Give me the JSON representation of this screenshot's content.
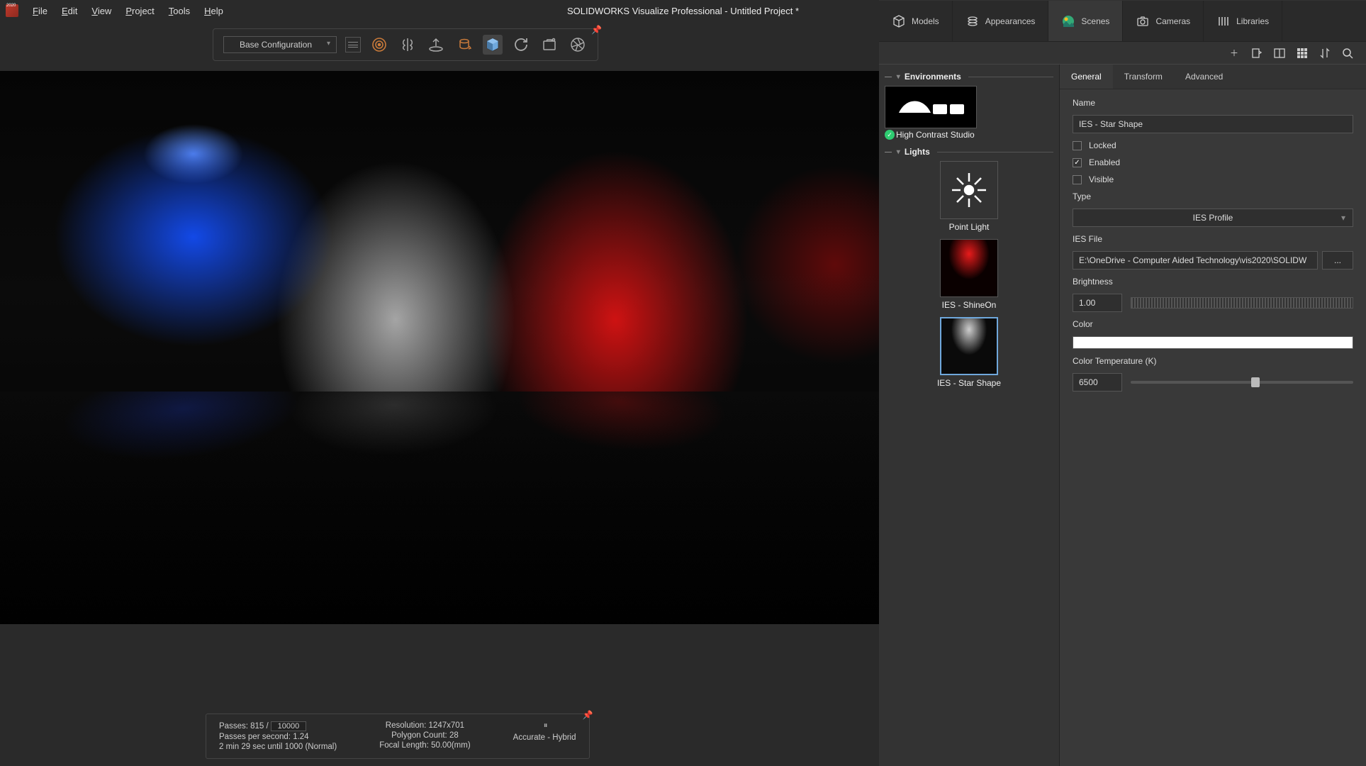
{
  "app_title": "SOLIDWORKS Visualize Professional - Untitled Project *",
  "menu": {
    "file": "File",
    "edit": "Edit",
    "view": "View",
    "project": "Project",
    "tools": "Tools",
    "help": "Help"
  },
  "toolbar": {
    "config": "Base Configuration"
  },
  "status": {
    "passes_label": "Passes:",
    "passes_cur": "815",
    "passes_sep": "/",
    "passes_total": "10000",
    "pps": "Passes per second: 1.24",
    "eta": "2 min 29 sec until 1000 (Normal)",
    "res": "Resolution: 1247x701",
    "poly": "Polygon Count: 28",
    "focal": "Focal Length: 50.00(mm)",
    "mode": "Accurate - Hybrid"
  },
  "main_tabs": {
    "models": "Models",
    "appearances": "Appearances",
    "scenes": "Scenes",
    "cameras": "Cameras",
    "libraries": "Libraries"
  },
  "sections": {
    "env": "Environments",
    "lights": "Lights"
  },
  "env": {
    "name": "High Contrast Studio"
  },
  "lights": {
    "l0": "Point Light",
    "l1": "IES - ShineOn",
    "l2": "IES - Star Shape"
  },
  "prop_tabs": {
    "general": "General",
    "transform": "Transform",
    "advanced": "Advanced"
  },
  "props": {
    "name_label": "Name",
    "name_value": "IES - Star Shape",
    "locked": "Locked",
    "enabled": "Enabled",
    "visible": "Visible",
    "type_label": "Type",
    "type_value": "IES Profile",
    "iesfile_label": "IES File",
    "iesfile_value": "E:\\OneDrive - Computer Aided Technology\\vis2020\\SOLIDW",
    "browse": "...",
    "brightness_label": "Brightness",
    "brightness_value": "1.00",
    "color_label": "Color",
    "ct_label": "Color Temperature (K)",
    "ct_value": "6500"
  }
}
